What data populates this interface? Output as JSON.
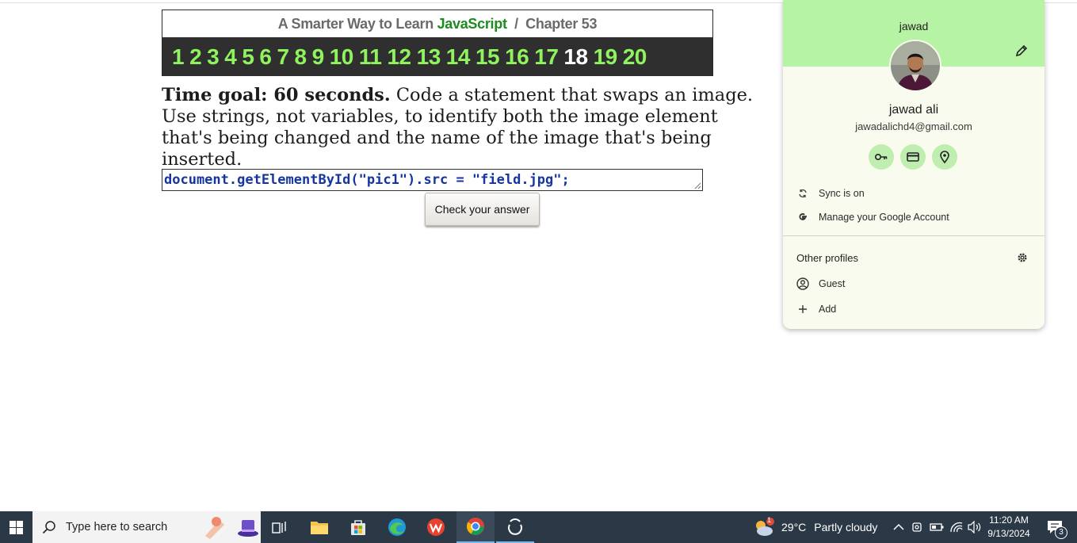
{
  "header": {
    "title_prefix": "A Smarter Way to Learn",
    "title_brand": "JavaScript",
    "title_separator": "/",
    "chapter": "Chapter 53",
    "numbers": [
      "1",
      "2",
      "3",
      "4",
      "5",
      "6",
      "7",
      "8",
      "9",
      "10",
      "11",
      "12",
      "13",
      "14",
      "15",
      "16",
      "17",
      "18",
      "19",
      "20"
    ],
    "current": "18"
  },
  "exercise": {
    "goal": "Time goal: 60 seconds.",
    "instruction": "Code a statement that swaps an image. Use strings, not variables, to identify both the image element that's being changed and the name of the image that's being inserted.",
    "answer_value": "document.getElementById(\"pic1\").src = \"field.jpg\";",
    "check_label": "Check your answer"
  },
  "profile_menu": {
    "banner_name": "jawad",
    "full_name": "jawad ali",
    "email": "jawadalichd4@gmail.com",
    "quick_actions": [
      "key-icon",
      "card-icon",
      "location-pin-icon"
    ],
    "sync_label": "Sync is on",
    "manage_label": "Manage your Google Account",
    "other_profiles_title": "Other profiles",
    "guest_label": "Guest",
    "add_label": "Add"
  },
  "taskbar": {
    "search_placeholder": "Type here to search",
    "weather_temp": "29°C",
    "weather_desc": "Partly cloudy",
    "weather_badge": "1",
    "time": "11:20 AM",
    "date": "9/13/2024",
    "notification_count": "3"
  },
  "colors": {
    "nav_bg": "#2f2f2f",
    "nav_num": "#8ff35e",
    "brand": "#1f8a1f",
    "profile_banner": "#b7f3a4",
    "taskbar": "#2b3947"
  }
}
